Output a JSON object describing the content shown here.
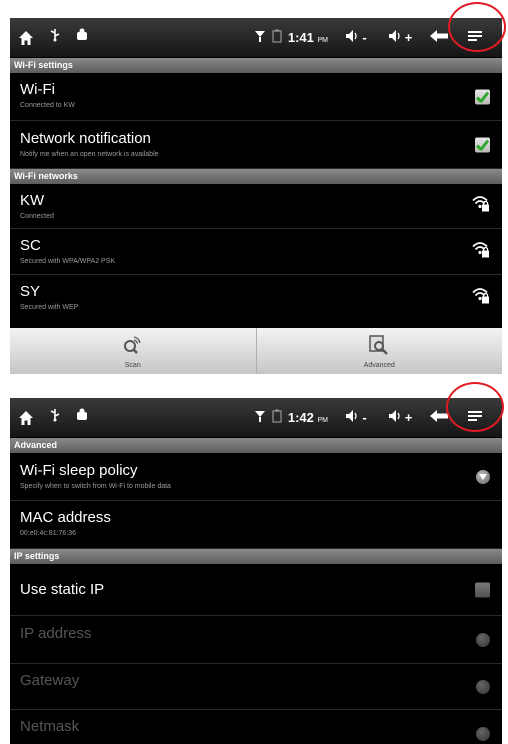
{
  "screen1": {
    "status": {
      "time": "1:41",
      "ampm": "PM",
      "vol_down": "-",
      "vol_up": "+"
    },
    "sections": [
      {
        "header": "Wi-Fi settings"
      },
      {
        "header": "Wi-Fi networks"
      }
    ],
    "rows": [
      {
        "title": "Wi-Fi",
        "subtitle": "Connected to KW",
        "control": "checkbox",
        "checked": true
      },
      {
        "title": "Network notification",
        "subtitle": "Notify me when an open network is available",
        "control": "checkbox",
        "checked": true
      },
      {
        "title": "KW",
        "subtitle": "Connected",
        "control": "wifi-lock-icon"
      },
      {
        "title": "SC",
        "subtitle": "Secured with WPA/WPA2 PSK",
        "control": "wifi-lock-icon"
      },
      {
        "title": "SY",
        "subtitle": "Secured with WEP",
        "control": "wifi-lock-icon"
      }
    ],
    "bottom": {
      "scan_label": "Scan",
      "advanced_label": "Advanced"
    }
  },
  "screen2": {
    "status": {
      "time": "1:42",
      "ampm": "PM",
      "vol_down": "-",
      "vol_up": "+"
    },
    "sections": [
      {
        "header": "Advanced"
      },
      {
        "header": "IP settings"
      }
    ],
    "rows": [
      {
        "title": "Wi-Fi sleep policy",
        "subtitle": "Specify when to switch from Wi-Fi to mobile data",
        "control": "dropdown"
      },
      {
        "title": "MAC address",
        "subtitle": "00:e0:4c:81:76:36"
      },
      {
        "title": "Use static IP",
        "control": "checkbox",
        "checked": false
      },
      {
        "title": "IP address",
        "subtitle": "",
        "control": "disabled-dot",
        "disabled": true
      },
      {
        "title": "Gateway",
        "subtitle": "",
        "control": "disabled-dot",
        "disabled": true
      },
      {
        "title": "Netmask",
        "control": "disabled-dot",
        "disabled": true
      }
    ]
  },
  "colors": {
    "highlight": "#e21b24",
    "check_green": "#2fa82f",
    "background": "#000000"
  }
}
